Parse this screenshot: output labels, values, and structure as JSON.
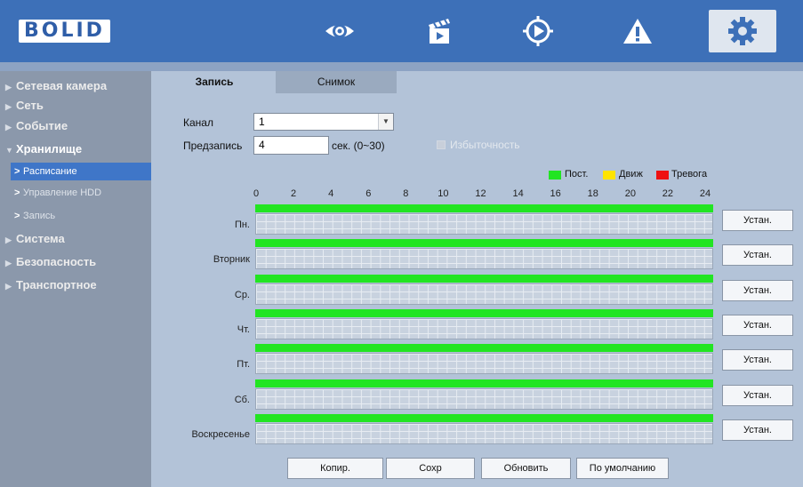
{
  "header": {
    "logo": "BOLID",
    "nav": [
      {
        "name": "live-view",
        "icon": "eye-icon"
      },
      {
        "name": "playback",
        "icon": "clapper-icon"
      },
      {
        "name": "ptz",
        "icon": "target-icon"
      },
      {
        "name": "alarm",
        "icon": "warning-icon"
      },
      {
        "name": "settings",
        "icon": "gear-icon",
        "active": true
      }
    ]
  },
  "sidebar": {
    "items": [
      {
        "label": "Сетевая камера"
      },
      {
        "label": "Сеть"
      },
      {
        "label": "Событие"
      },
      {
        "label": "Хранилище",
        "expanded": true,
        "children": [
          {
            "label": "Расписание",
            "active": true
          },
          {
            "label": "Управление HDD"
          },
          {
            "label": "Запись"
          }
        ]
      },
      {
        "label": "Система"
      },
      {
        "label": "Безопасность"
      },
      {
        "label": "Транспортное"
      }
    ]
  },
  "tabs": [
    {
      "label": "Запись",
      "active": true
    },
    {
      "label": "Снимок"
    }
  ],
  "form": {
    "channel_label": "Канал",
    "channel_value": "1",
    "prerecord_label": "Предзапись",
    "prerecord_value": "4",
    "prerecord_unit": "сек. (0~30)",
    "redundancy_label": "Избыточность",
    "redundancy_checked": false
  },
  "legend": [
    {
      "label": "Пост.",
      "color": "#22e522"
    },
    {
      "label": "Движ",
      "color": "#ffe400"
    },
    {
      "label": "Тревога",
      "color": "#ee1111"
    }
  ],
  "hours": [
    "0",
    "2",
    "4",
    "6",
    "8",
    "10",
    "12",
    "14",
    "16",
    "18",
    "20",
    "22",
    "24"
  ],
  "days": [
    {
      "label": "Пн.",
      "set_label": "Устан."
    },
    {
      "label": "Вторник",
      "set_label": "Устан."
    },
    {
      "label": "Ср.",
      "set_label": "Устан."
    },
    {
      "label": "Чт.",
      "set_label": "Устан."
    },
    {
      "label": "Пт.",
      "set_label": "Устан."
    },
    {
      "label": "Сб.",
      "set_label": "Устан."
    },
    {
      "label": "Воскресенье",
      "set_label": "Устан."
    }
  ],
  "buttons": {
    "copy": "Копир.",
    "save": "Сохр",
    "refresh": "Обновить",
    "default": "По умолчанию"
  }
}
